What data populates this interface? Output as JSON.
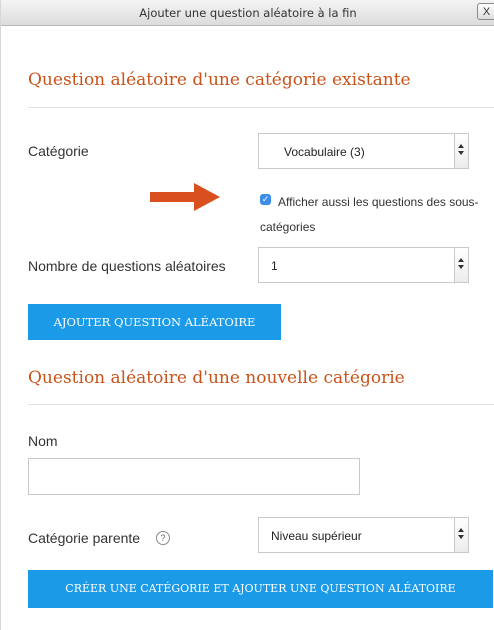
{
  "window": {
    "title": "Ajouter une question aléatoire à la fin",
    "close_label": "X"
  },
  "existing": {
    "heading": "Question aléatoire d'une catégorie existante",
    "category_label": "Catégorie",
    "category_value": "Vocabulaire (3)",
    "include_sub_label": "Afficher aussi les questions des sous-catégories",
    "include_sub_checked": true,
    "count_label": "Nombre de questions aléatoires",
    "count_value": "1",
    "add_button": "AJOUTER QUESTION ALÉATOIRE"
  },
  "new_category": {
    "heading": "Question aléatoire d'une nouvelle catégorie",
    "name_label": "Nom",
    "name_value": "",
    "parent_label": "Catégorie parente",
    "parent_value": "Niveau supérieur",
    "create_button": "CRÉER UNE CATÉGORIE ET AJOUTER UNE QUESTION ALÉATOIRE"
  },
  "colors": {
    "heading": "#c8531a",
    "button": "#1b9ae8",
    "annotation_arrow": "#d9501e",
    "checkbox": "#3d8ee9"
  },
  "icons": {
    "help": "question-circle-icon",
    "annotation": "arrow-right-icon",
    "close": "close-icon"
  }
}
